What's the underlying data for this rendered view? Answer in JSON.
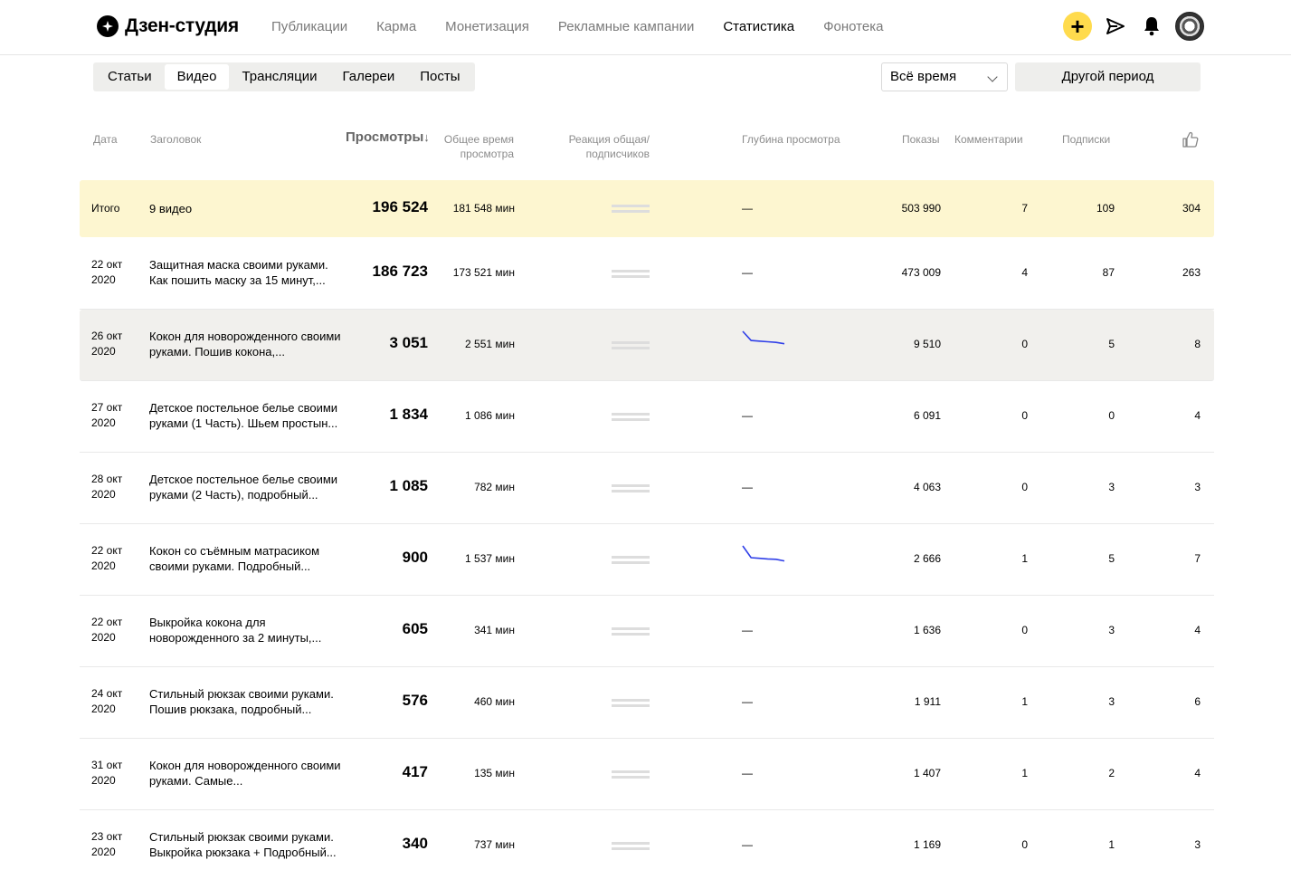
{
  "header": {
    "logo_text": "Дзен-студия",
    "nav": [
      "Публикации",
      "Карма",
      "Монетизация",
      "Рекламные кампании",
      "Статистика",
      "Фонотека"
    ],
    "active_nav": "Статистика",
    "plus_label": "+"
  },
  "toolbar": {
    "tabs": [
      "Статьи",
      "Видео",
      "Трансляции",
      "Галереи",
      "Посты"
    ],
    "active_tab": "Видео",
    "period_value": "Всё время",
    "other_period_label": "Другой период"
  },
  "columns": {
    "date": "Дата",
    "title": "Заголовок",
    "views": "Просмотры",
    "views_sort": "↓",
    "total_time": "Общее время просмотра",
    "reaction": "Реакция общая/ подписчиков",
    "depth": "Глубина просмотра",
    "shows": "Показы",
    "comments": "Комментарии",
    "subscriptions": "Подписки",
    "likes_icon": "thumbs-up-icon"
  },
  "total": {
    "label": "Итого",
    "title": "9 видео",
    "views": "196 524",
    "time": "181 548 мин",
    "depth": "—",
    "shows": "503 990",
    "comments": "7",
    "subs": "109",
    "likes": "304"
  },
  "rows": [
    {
      "date": "22 окт 2020",
      "title": "Защитная маска своими руками. Как пошить маску за 15 минут,...",
      "views": "186 723",
      "time": "173 521 мин",
      "depth": "—",
      "depth_curve": null,
      "shows": "473 009",
      "comments": "4",
      "subs": "87",
      "likes": "263"
    },
    {
      "date": "26 окт 2020",
      "title": "Кокон для новорожденного своими руками. Пошив кокона,...",
      "views": "3 051",
      "time": "2 551 мин",
      "depth": "",
      "depth_curve": [
        1.0,
        0.72,
        0.7,
        0.68,
        0.66,
        0.62
      ],
      "shows": "9 510",
      "comments": "0",
      "subs": "5",
      "likes": "8"
    },
    {
      "date": "27 окт 2020",
      "title": "Детское постельное белье своими руками (1 Часть). Шьем простын...",
      "views": "1 834",
      "time": "1 086 мин",
      "depth": "—",
      "depth_curve": null,
      "shows": "6 091",
      "comments": "0",
      "subs": "0",
      "likes": "4"
    },
    {
      "date": "28 окт 2020",
      "title": "Детское постельное белье своими руками (2 Часть), подробный...",
      "views": "1 085",
      "time": "782 мин",
      "depth": "—",
      "depth_curve": null,
      "shows": "4 063",
      "comments": "0",
      "subs": "3",
      "likes": "3"
    },
    {
      "date": "22 окт 2020",
      "title": "Кокон со съёмным матрасиком своими руками. Подробный...",
      "views": "900",
      "time": "1 537 мин",
      "depth": "",
      "depth_curve": [
        1.0,
        0.64,
        0.62,
        0.6,
        0.59,
        0.54
      ],
      "shows": "2 666",
      "comments": "1",
      "subs": "5",
      "likes": "7"
    },
    {
      "date": "22 окт 2020",
      "title": "Выкройка кокона для новорожденного за 2 минуты,...",
      "views": "605",
      "time": "341 мин",
      "depth": "—",
      "depth_curve": null,
      "shows": "1 636",
      "comments": "0",
      "subs": "3",
      "likes": "4"
    },
    {
      "date": "24 окт 2020",
      "title": "Стильный рюкзак своими руками. Пошив рюкзака, подробный...",
      "views": "576",
      "time": "460 мин",
      "depth": "—",
      "depth_curve": null,
      "shows": "1 911",
      "comments": "1",
      "subs": "3",
      "likes": "6"
    },
    {
      "date": "31 окт 2020",
      "title": "Кокон для новорожденного своими руками. Самые...",
      "views": "417",
      "time": "135 мин",
      "depth": "—",
      "depth_curve": null,
      "shows": "1 407",
      "comments": "1",
      "subs": "2",
      "likes": "4"
    },
    {
      "date": "23 окт 2020",
      "title": "Стильный рюкзак своими руками. Выкройка рюкзака + Подробный...",
      "views": "340",
      "time": "737 мин",
      "depth": "—",
      "depth_curve": null,
      "shows": "1 169",
      "comments": "0",
      "subs": "1",
      "likes": "3"
    }
  ],
  "colors": {
    "accent": "#ffdb4d",
    "total_row_bg": "#fdf6d0",
    "highlight_row_bg": "#f1f0ed",
    "sparkline": "#2f3fe8"
  }
}
